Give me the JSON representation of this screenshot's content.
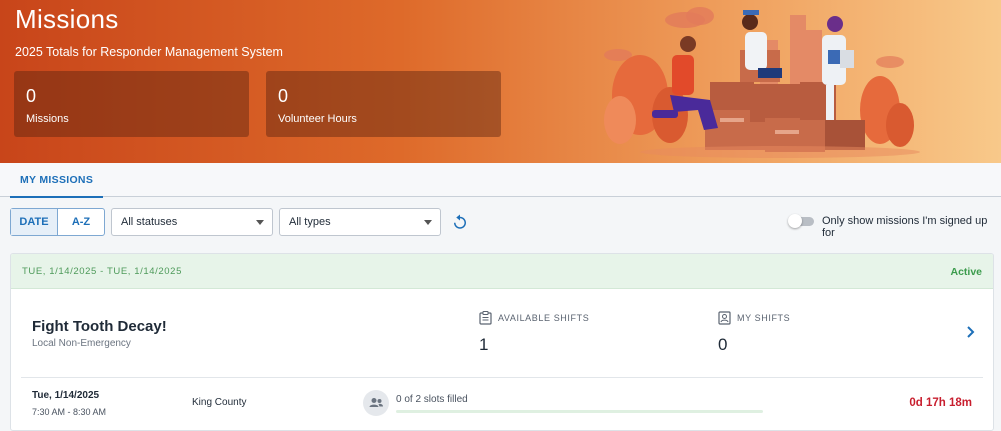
{
  "header": {
    "title": "Missions",
    "subtitle": "2025 Totals for Responder Management System",
    "stats": [
      {
        "value": "0",
        "label": "Missions"
      },
      {
        "value": "0",
        "label": "Volunteer Hours"
      }
    ]
  },
  "tabs": [
    {
      "label": "MY MISSIONS",
      "active": true
    }
  ],
  "toolbar": {
    "sort_buttons": [
      {
        "label": "DATE",
        "active": true
      },
      {
        "label": "A-Z",
        "active": false
      }
    ],
    "status_filter": "All statuses",
    "type_filter": "All types",
    "refresh_icon": "refresh-icon",
    "toggle_label": "Only show missions I'm signed up for",
    "toggle_on": false
  },
  "mission": {
    "date_range": "TUE, 1/14/2025 - TUE, 1/14/2025",
    "status": "Active",
    "title": "Fight Tooth Decay!",
    "type": "Local Non-Emergency",
    "available_shifts_label": "AVAILABLE SHIFTS",
    "available_shifts": "1",
    "my_shifts_label": "MY SHIFTS",
    "my_shifts": "0",
    "shift": {
      "date": "Tue, 1/14/2025",
      "time": "7:30 AM - 8:30 AM",
      "location": "King County",
      "slots_text": "0 of 2 slots filled",
      "slots_filled_fraction": 0,
      "countdown": "0d 17h 18m"
    }
  },
  "colors": {
    "accent": "#1d6fb8",
    "active_green": "#3b9b4c",
    "countdown_red": "#c81e2e",
    "header_orange": "#de6a2a"
  }
}
